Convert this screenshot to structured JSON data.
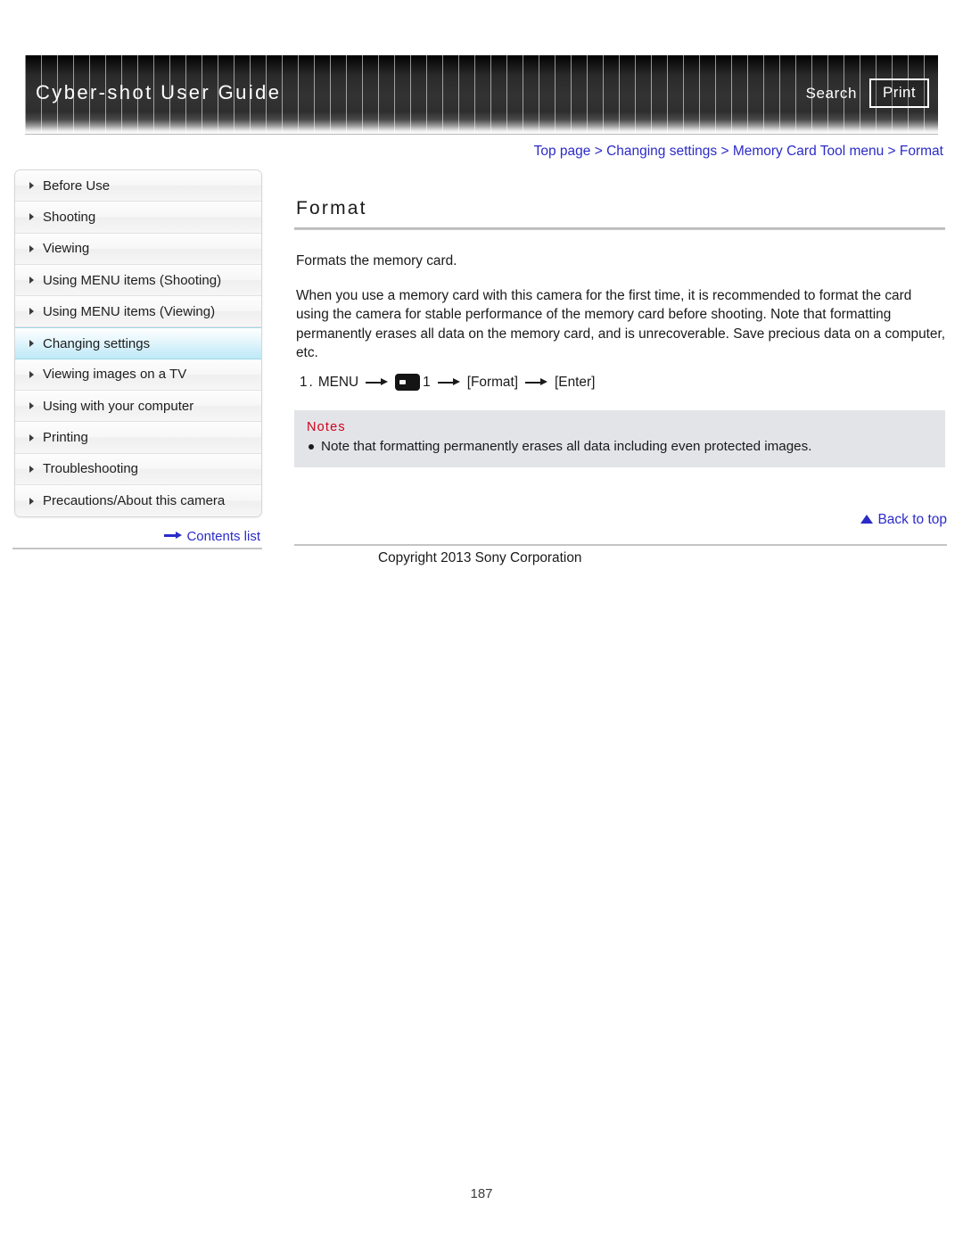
{
  "header": {
    "title": "Cyber-shot User Guide",
    "search_label": "Search",
    "print_label": "Print",
    "accent_color": "#2b2bc8"
  },
  "breadcrumb": {
    "text": "Top page > Changing settings > Memory Card Tool menu > Format",
    "items": [
      "Top page",
      "Changing settings",
      "Memory Card Tool menu",
      "Format"
    ],
    "separator": ">"
  },
  "sidebar": {
    "items": [
      {
        "label": "Before Use",
        "active": false
      },
      {
        "label": "Shooting",
        "active": false
      },
      {
        "label": "Viewing",
        "active": false
      },
      {
        "label": "Using MENU items (Shooting)",
        "active": false
      },
      {
        "label": "Using MENU items (Viewing)",
        "active": false
      },
      {
        "label": "Changing settings",
        "active": true
      },
      {
        "label": "Viewing images on a TV",
        "active": false
      },
      {
        "label": "Using with your computer",
        "active": false
      },
      {
        "label": "Printing",
        "active": false
      },
      {
        "label": "Troubleshooting",
        "active": false
      },
      {
        "label": "Precautions/About this camera",
        "active": false
      }
    ],
    "contents_list_label": "Contents list"
  },
  "main": {
    "heading": "Format",
    "lead": "Formats the memory card.",
    "body": "When you use a memory card with this camera for the first time, it is recommended to format the card using the camera for stable performance of the memory card before shooting. Note that formatting permanently erases all data on the memory card, and is unrecoverable. Save precious data on a computer, etc.",
    "step": {
      "number": "1.",
      "menu_label": "MENU",
      "icon_name": "memory-card-tool-icon",
      "tab_number": "1",
      "option_label": "[Format]",
      "enter_label": "[Enter]"
    },
    "notes": {
      "title": "Notes",
      "title_color": "#d0021b",
      "items": [
        "Note that formatting permanently erases all data including even protected images."
      ]
    },
    "back_to_top_label": "Back to top"
  },
  "footer": {
    "copyright": "Copyright 2013 Sony Corporation",
    "page_number": "187"
  }
}
